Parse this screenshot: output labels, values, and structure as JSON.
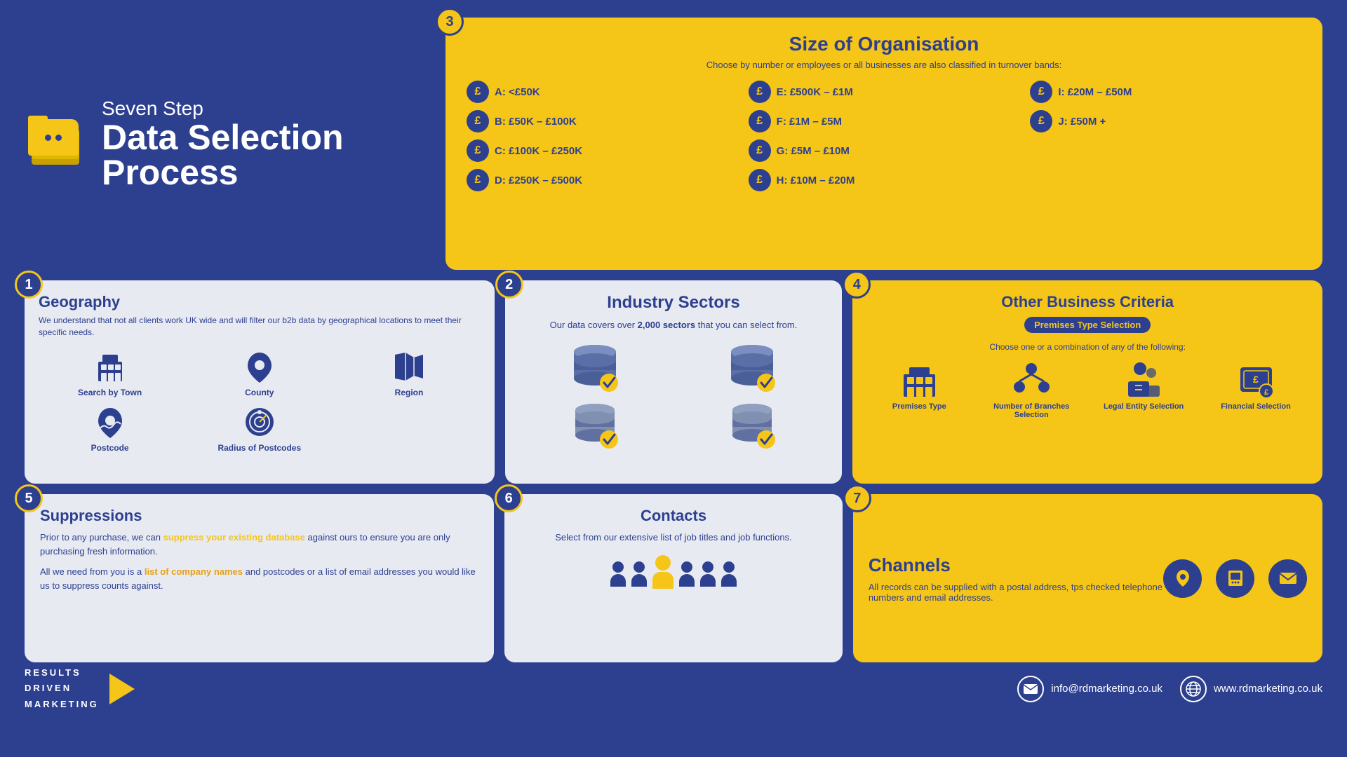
{
  "header": {
    "subtitle": "Seven Step",
    "title": "Data Selection Process"
  },
  "steps": {
    "step1": {
      "num": "1",
      "title": "Geography",
      "body": "We understand that not all clients work UK wide and will filter our b2b data by geographical locations to meet their specific needs.",
      "icons": [
        {
          "label": "Search by Town",
          "type": "building"
        },
        {
          "label": "County",
          "type": "location"
        },
        {
          "label": "Region",
          "type": "map"
        },
        {
          "label": "Postcode",
          "type": "postcode"
        },
        {
          "label": "Radius of Postcodes",
          "type": "radius"
        }
      ]
    },
    "step2": {
      "num": "2",
      "title": "Industry Sectors",
      "body": "Our data covers over",
      "highlight": "2,000 sectors",
      "body2": "that you can select from."
    },
    "step3": {
      "num": "3",
      "title": "Size of Organisation",
      "subtitle": "Choose by number or employees or all businesses are also classified in turnover bands:",
      "bands": [
        {
          "label": "A: <£50K"
        },
        {
          "label": "B: £50K – £100K"
        },
        {
          "label": "C: £100K – £250K"
        },
        {
          "label": "D: £250K – £500K"
        },
        {
          "label": "E: £500K – £1M"
        },
        {
          "label": "F: £1M – £5M"
        },
        {
          "label": "G: £5M – £10M"
        },
        {
          "label": "H: £10M – £20M"
        },
        {
          "label": "I: £20M – £50M"
        },
        {
          "label": "J: £50M +"
        }
      ]
    },
    "step4": {
      "num": "4",
      "title": "Other Business Criteria",
      "badge": "Premises Type Selection",
      "choose": "Choose one or a combination of any of the following:",
      "criteria": [
        {
          "label": "Premises Type",
          "type": "building"
        },
        {
          "label": "Number of Branches Selection",
          "type": "branches"
        },
        {
          "label": "Legal Entity Selection",
          "type": "legal"
        },
        {
          "label": "Financial Selection",
          "type": "financial"
        }
      ]
    },
    "step5": {
      "num": "5",
      "title": "Suppressions",
      "body1": "Prior to any purchase, we can",
      "highlight1": "suppress your existing database",
      "body2": "against ours to ensure you are only purchasing fresh information.",
      "body3": "All we need from you is a",
      "highlight2": "list of company names",
      "body4": "and postcodes or a list of email addresses you would like us to suppress counts against."
    },
    "step6": {
      "num": "6",
      "title": "Contacts",
      "body": "Select from our extensive list of job titles and job functions."
    },
    "step7": {
      "num": "7",
      "title": "Channels",
      "body": "All records can be supplied with a postal address, tps checked telephone numbers and email addresses."
    }
  },
  "footer": {
    "logo_lines": [
      "RESULTS",
      "DRIVEN",
      "MARKETING"
    ],
    "email": "info@rdmarketing.co.uk",
    "website": "www.rdmarketing.co.uk"
  }
}
